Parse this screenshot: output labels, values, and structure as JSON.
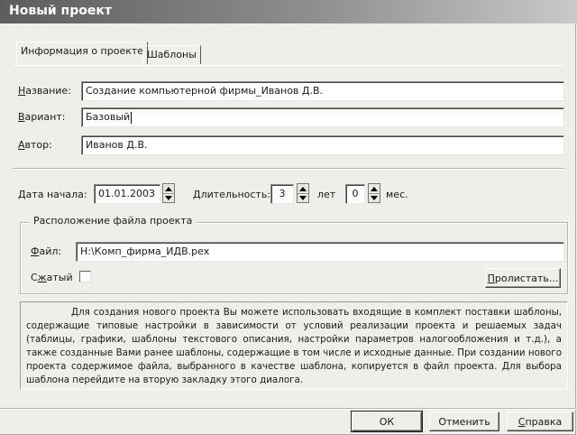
{
  "window": {
    "title": "Новый проект"
  },
  "tabs": [
    {
      "label": "Информация о проекте",
      "active": true
    },
    {
      "label": "Шаблоны",
      "active": false
    }
  ],
  "form": {
    "name": {
      "label_u": "Н",
      "label_rest": "азвание:",
      "value": "Создание компьютерной фирмы_Иванов Д.В."
    },
    "variant": {
      "label_u": "В",
      "label_rest": "ариант:",
      "value": "Базовый"
    },
    "author": {
      "label_u": "А",
      "label_rest": "втор:",
      "value": "Иванов Д.В."
    }
  },
  "timing": {
    "start_label_u": "Д",
    "start_label_rest": "ата начала:",
    "start_value": "01.01.2003",
    "duration_label_u": "Д",
    "duration_label_rest": "лительность:",
    "years_value": "3",
    "years_unit": "лет",
    "months_value": "0",
    "months_unit": "мес."
  },
  "file_group": {
    "title": "Расположение файла проекта",
    "file_label_u": "Ф",
    "file_label_rest": "айл:",
    "file_value": "H:\\Комп_фирма_ИДВ.pex",
    "compressed_label_pre": "С",
    "compressed_label_u": "ж",
    "compressed_label_rest": "атый",
    "compressed_checked": false,
    "browse_label_u": "П",
    "browse_label_rest": "ролистать..."
  },
  "info_text": "Для создания нового проекта Вы можете использовать входящие в комплект поставки шаблоны, содержащие типовые настройки в зависимости от условий реализации проекта и решаемых задач (таблицы, графики, шаблоны текстового описания, настройки параметров налогообложения и т.д.), а также созданные Вами ранее шаблоны, содержащие в том числе и исходные данные. При создании нового проекта содержимое файла, выбранного в качестве шаблона, копируется в файл проекта. Для выбора шаблона перейдите на вторую закладку этого диалога.",
  "buttons": {
    "ok": "ОК",
    "cancel": "Отменить",
    "help_u": "С",
    "help_rest": "правка"
  }
}
